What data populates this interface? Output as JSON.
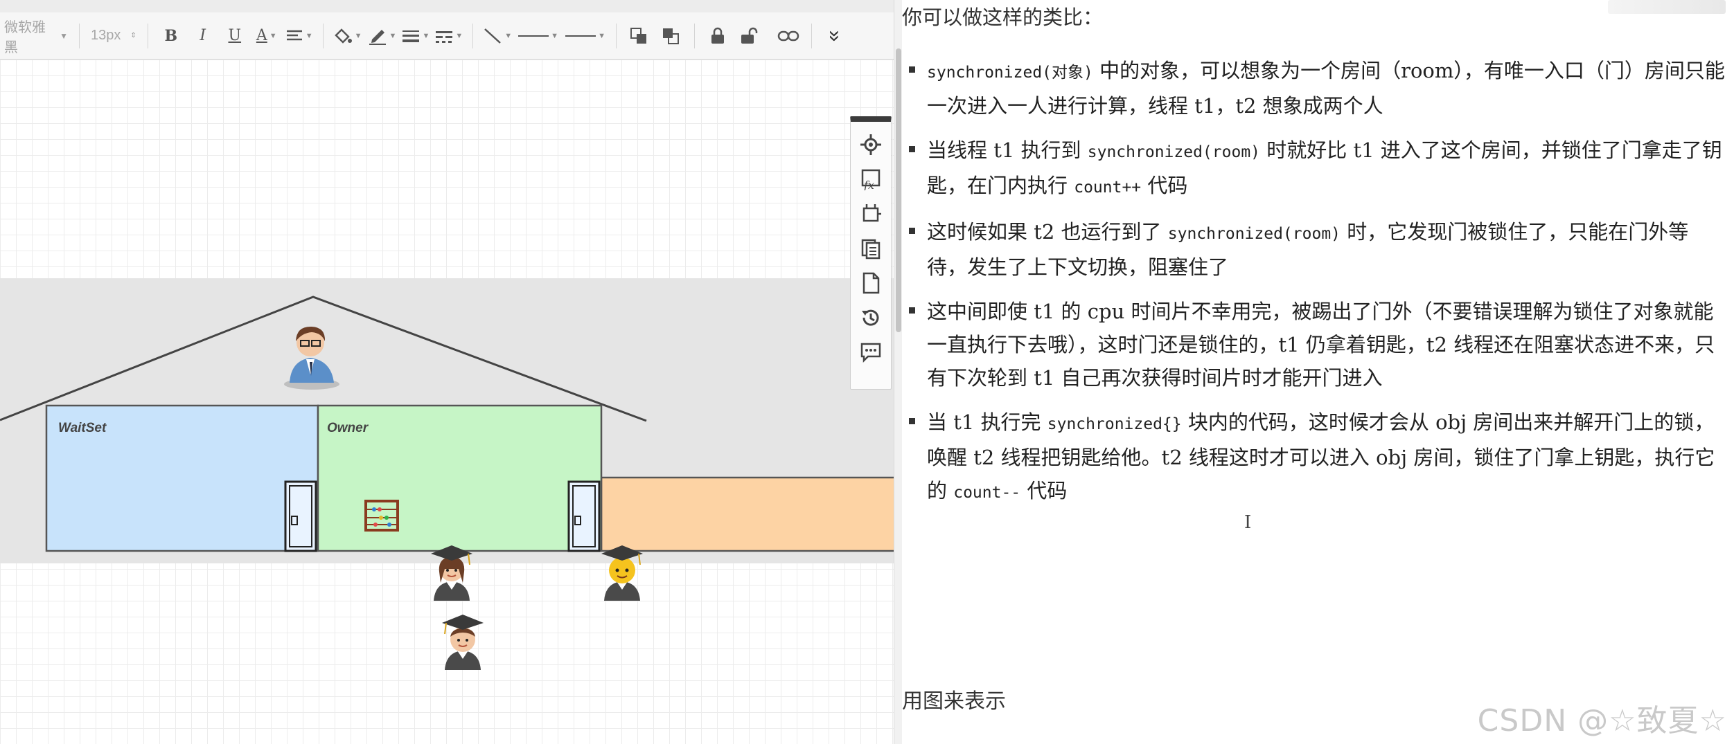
{
  "toolbar": {
    "font_family": "微软雅黑",
    "font_size": "13px",
    "bold": "B",
    "italic": "I",
    "underline": "U",
    "font_color": "A",
    "more": "»"
  },
  "canvas": {
    "waitset_label": "WaitSet",
    "owner_label": "Owner",
    "colors": {
      "waitset": "#c8e3fb",
      "owner": "#c6f5c6",
      "entry": "#fdd3a4",
      "band": "#e5e5e5",
      "roof": "#444444"
    },
    "icons": [
      "teacher-icon",
      "abacus-icon",
      "student-girl-icon",
      "student-boy-icon",
      "student-waiting-icon"
    ]
  },
  "side_tools": [
    "locate-icon",
    "formula-icon",
    "crop-icon",
    "copy-icon",
    "page-icon",
    "history-icon",
    "comment-icon"
  ],
  "notes": {
    "intro": "你可以做这样的类比：",
    "items": [
      {
        "p1": "synchronized(对象)",
        "p2": " 中的对象，可以想象为一个房间（",
        "p3": "room",
        "p4": "），有唯一入口（门）房间只能一次进入一人进行计算，线程 ",
        "p5": "t1，t2",
        "p6": " 想象成两个人"
      },
      {
        "p1": "当线程 ",
        "p2": "t1",
        "p3": " 执行到 ",
        "p4": "synchronized(room)",
        "p5": " 时就好比 ",
        "p6": "t1",
        "p7": " 进入了这个房间，并锁住了门拿走了钥匙，在门内执行 ",
        "p8": "count++",
        "p9": " 代码"
      },
      {
        "p1": "这时候如果 ",
        "p2": "t2",
        "p3": " 也运行到了 ",
        "p4": "synchronized(room)",
        "p5": " 时，它发现门被锁住了，只能在门外等待，发生了上下文切换，阻塞住了"
      },
      {
        "p1": "这中间即使 ",
        "p2": "t1",
        "p3": " 的 ",
        "p4": "cpu",
        "p5": " 时间片不幸用完，被踢出了门外（不要错误理解为锁住了对象就能一直执行下去哦），这时门还是锁住的，",
        "p6": "t1",
        "p7": " 仍拿着钥匙，",
        "p8": "t2",
        "p9": " 线程还在阻塞状态进不来，只有下次轮到 ",
        "p10": "t1",
        "p11": " 自己再次获得时间片时才能开门进入"
      },
      {
        "p1": "当 ",
        "p2": "t1",
        "p3": " 执行完 ",
        "p4": "synchronized{}",
        "p5": " 块内的代码，这时候才会从 ",
        "p6": "obj",
        "p7": " 房间出来并解开门上的锁，唤醒 ",
        "p8": "t2",
        "p9": " 线程把钥匙给他。",
        "p10": "t2",
        "p11": " 线程这时才可以进入 ",
        "p12": "obj",
        "p13": " 房间，锁住了门拿上钥匙，执行它的 ",
        "p14": "count--",
        "p15": " 代码"
      }
    ],
    "footer": "用图来表示",
    "watermark": "CSDN @☆致夏☆",
    "cursor": "I"
  }
}
